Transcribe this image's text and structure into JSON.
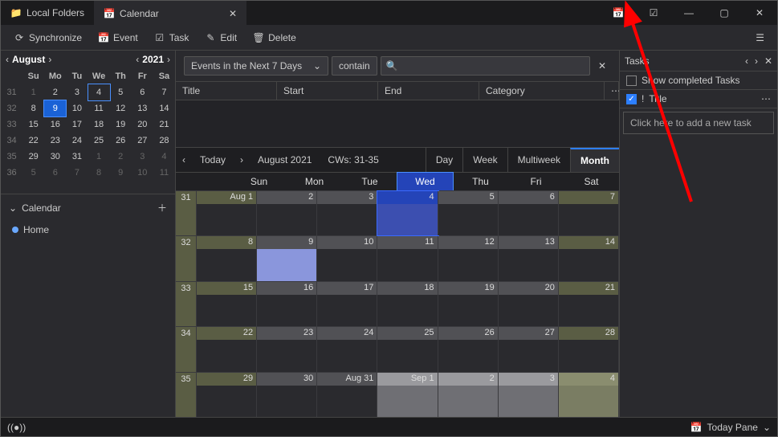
{
  "tabs": {
    "folders": "Local Folders",
    "calendar": "Calendar"
  },
  "toolbar": {
    "sync": "Synchronize",
    "event": "Event",
    "task": "Task",
    "edit": "Edit",
    "delete": "Delete"
  },
  "mini": {
    "month": "August",
    "year": "2021",
    "dow": [
      "Su",
      "Mo",
      "Tu",
      "We",
      "Th",
      "Fr",
      "Sa"
    ],
    "weeks": [
      {
        "wk": "31",
        "d": [
          "1",
          "2",
          "3",
          "4",
          "5",
          "6",
          "7"
        ],
        "off": [
          0
        ]
      },
      {
        "wk": "32",
        "d": [
          "8",
          "9",
          "10",
          "11",
          "12",
          "13",
          "14"
        ]
      },
      {
        "wk": "33",
        "d": [
          "15",
          "16",
          "17",
          "18",
          "19",
          "20",
          "21"
        ]
      },
      {
        "wk": "34",
        "d": [
          "22",
          "23",
          "24",
          "25",
          "26",
          "27",
          "28"
        ]
      },
      {
        "wk": "35",
        "d": [
          "29",
          "30",
          "31",
          "1",
          "2",
          "3",
          "4"
        ],
        "off": [
          3,
          4,
          5,
          6
        ]
      },
      {
        "wk": "36",
        "d": [
          "5",
          "6",
          "7",
          "8",
          "9",
          "10",
          "11"
        ],
        "off": [
          0,
          1,
          2,
          3,
          4,
          5,
          6
        ]
      }
    ],
    "today": [
      0,
      3
    ],
    "sel": [
      1,
      1
    ]
  },
  "calsec": {
    "title": "Calendar",
    "items": [
      "Home"
    ]
  },
  "filter": {
    "dd": "Events in the Next 7 Days",
    "contain": "contain"
  },
  "cols": {
    "title": "Title",
    "start": "Start",
    "end": "End",
    "cat": "Category"
  },
  "view": {
    "today": "Today",
    "range": "August 2021",
    "cws": "CWs: 31-35",
    "modes": [
      "Day",
      "Week",
      "Multiweek",
      "Month"
    ],
    "active": 3
  },
  "grid": {
    "dow": [
      "Sun",
      "Mon",
      "Tue",
      "Wed",
      "Thu",
      "Fri",
      "Sat"
    ],
    "selCol": 3,
    "rows": [
      {
        "wk": "31",
        "d": [
          "Aug 1",
          "2",
          "3",
          "4",
          "5",
          "6",
          "7"
        ]
      },
      {
        "wk": "32",
        "d": [
          "8",
          "9",
          "10",
          "11",
          "12",
          "13",
          "14"
        ]
      },
      {
        "wk": "33",
        "d": [
          "15",
          "16",
          "17",
          "18",
          "19",
          "20",
          "21"
        ]
      },
      {
        "wk": "34",
        "d": [
          "22",
          "23",
          "24",
          "25",
          "26",
          "27",
          "28"
        ]
      },
      {
        "wk": "35",
        "d": [
          "29",
          "30",
          "Aug 31",
          "Sep 1",
          "2",
          "3",
          "4"
        ]
      }
    ]
  },
  "tasks": {
    "title": "Tasks",
    "show": "Show completed Tasks",
    "colTitle": "Title",
    "add": "Click here to add a new task"
  },
  "status": {
    "todaypane": "Today Pane"
  }
}
